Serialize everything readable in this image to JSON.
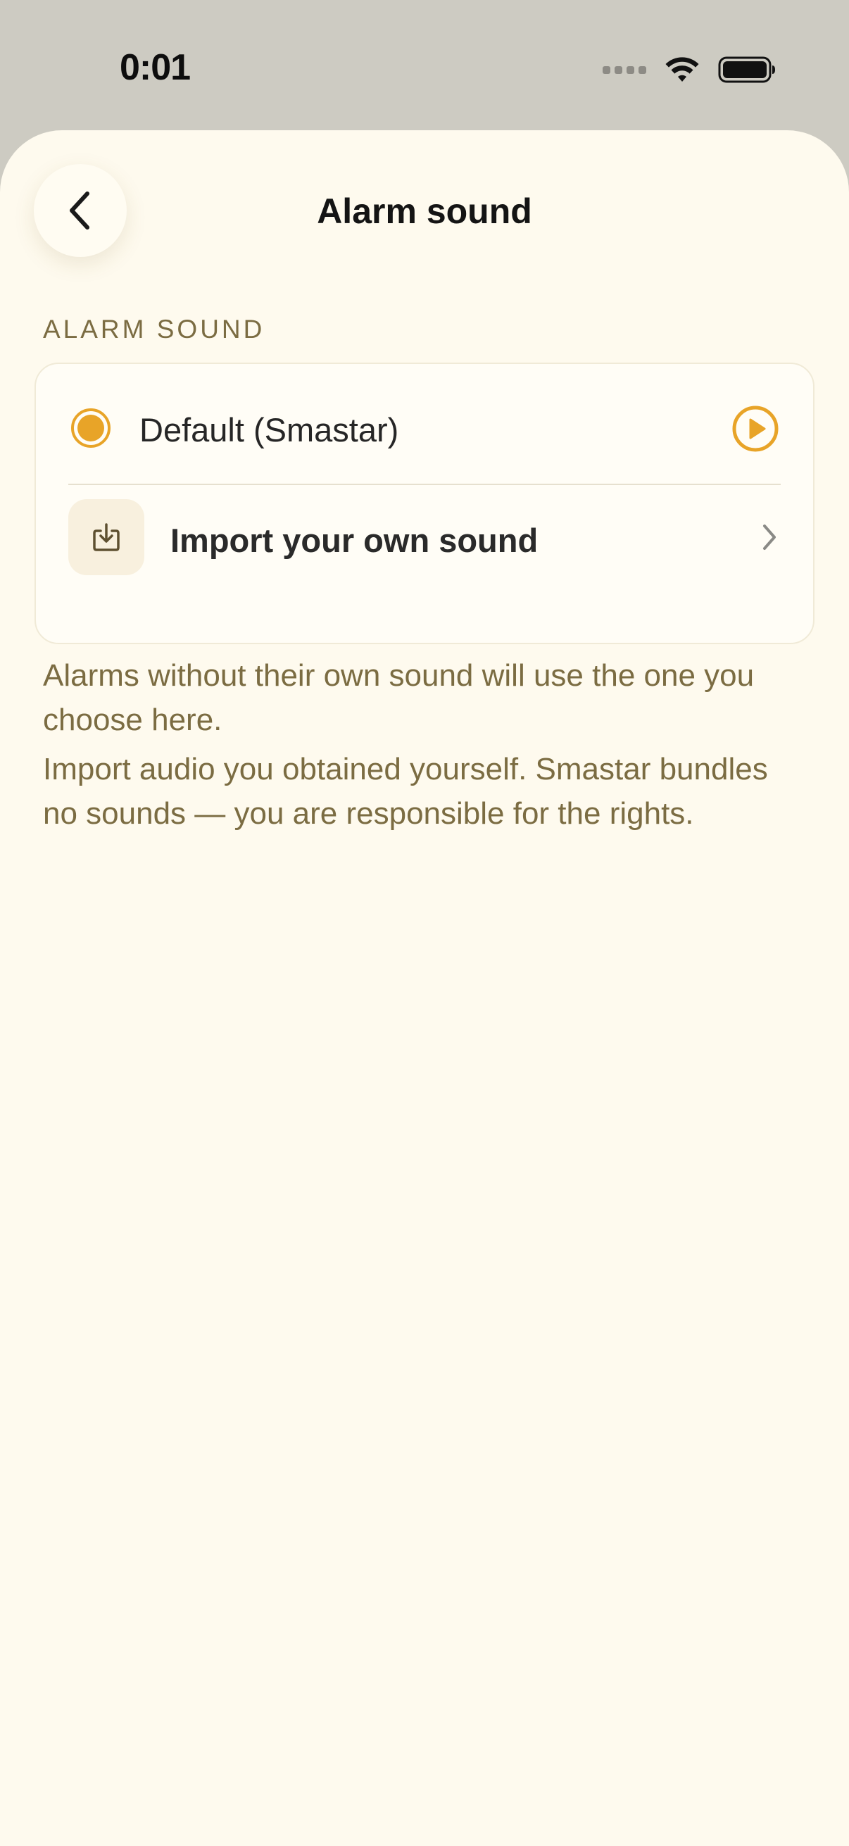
{
  "status_bar": {
    "time": "0:01",
    "icons": [
      "signal-dots-icon",
      "wifi-icon",
      "battery-icon"
    ]
  },
  "header": {
    "back_icon": "chevron-left-icon",
    "title": "Alarm sound"
  },
  "section": {
    "header": "ALARM SOUND"
  },
  "options": {
    "default_label": "Default (Smastar)",
    "default_selected": true,
    "play_icon": "play-circle-icon",
    "import_label": "Import your own sound",
    "import_icon": "import-download-icon",
    "chevron_icon": "chevron-right-icon"
  },
  "footnotes": {
    "fallback": "Alarms without their own sound will use the one you choose here.",
    "rights": "Import audio you obtained yourself. Smastar bundles no sounds — you are responsible for the rights."
  },
  "colors": {
    "accent": "#e8a428",
    "background": "#fefaee",
    "status_bar_bg": "#cdcbc2",
    "muted_text": "#7b6c42"
  }
}
